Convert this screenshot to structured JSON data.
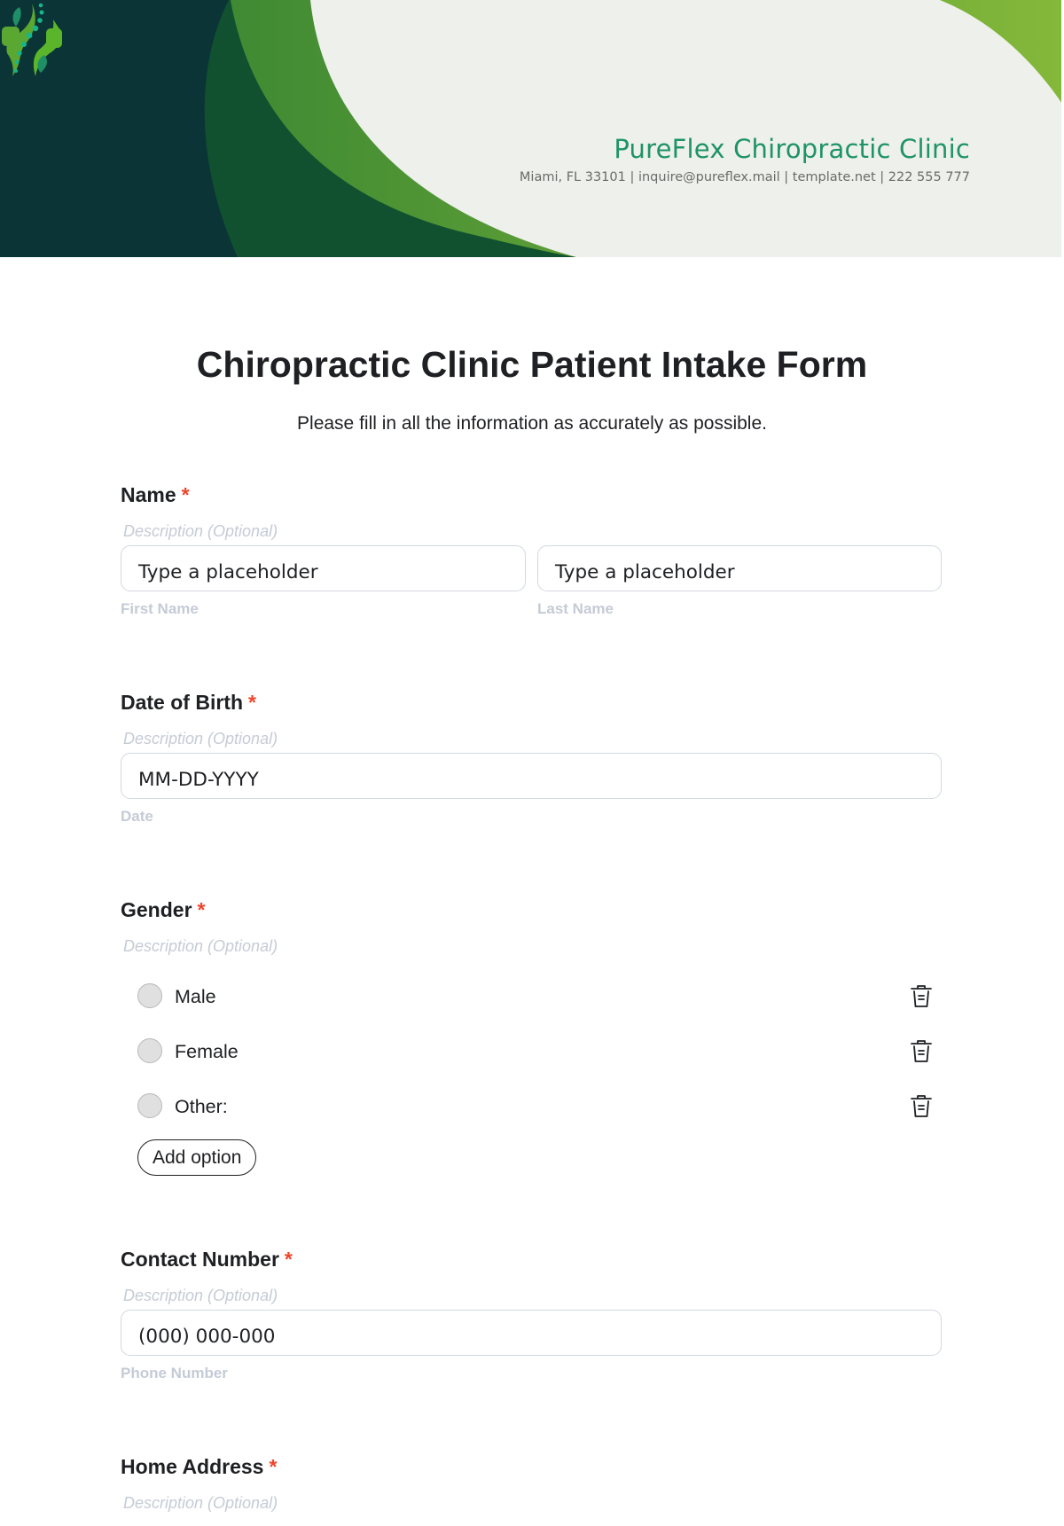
{
  "header": {
    "clinic_name": "PureFlex Chiropractic Clinic",
    "contact_line": "Miami, FL 33101 | inquire@pureflex.mail | template.net | 222 555 777",
    "logo_icon": "spine-cross-logo",
    "colors": {
      "dark_teal": "#0b3436",
      "dark_green": "#115130",
      "bright_green_start": "#3f8a33",
      "bright_green_end": "#84b83a",
      "cream": "#eef0eb",
      "brand_text": "#1e9466"
    }
  },
  "form": {
    "title": "Chiropractic Clinic Patient Intake Form",
    "subtitle": "Please fill in all the information as accurately as possible.",
    "required_marker": "*",
    "fields": {
      "name": {
        "label": "Name",
        "description": "Description (Optional)",
        "first": {
          "placeholder": "Type a placeholder",
          "sublabel": "First Name"
        },
        "last": {
          "placeholder": "Type a placeholder",
          "sublabel": "Last Name"
        }
      },
      "dob": {
        "label": "Date of Birth",
        "description": "Description (Optional)",
        "placeholder": "MM-DD-YYYY",
        "sublabel": "Date"
      },
      "gender": {
        "label": "Gender",
        "description": "Description (Optional)",
        "options": [
          {
            "label": "Male",
            "selected": false
          },
          {
            "label": "Female",
            "selected": false
          },
          {
            "label": "Other:",
            "selected": false
          }
        ],
        "add_option_label": "Add option",
        "delete_icon": "trash-icon"
      },
      "contact": {
        "label": "Contact Number",
        "description": "Description (Optional)",
        "placeholder": "(000) 000-000",
        "sublabel": "Phone Number"
      },
      "address": {
        "label": "Home Address",
        "description": "Description (Optional)"
      }
    }
  }
}
